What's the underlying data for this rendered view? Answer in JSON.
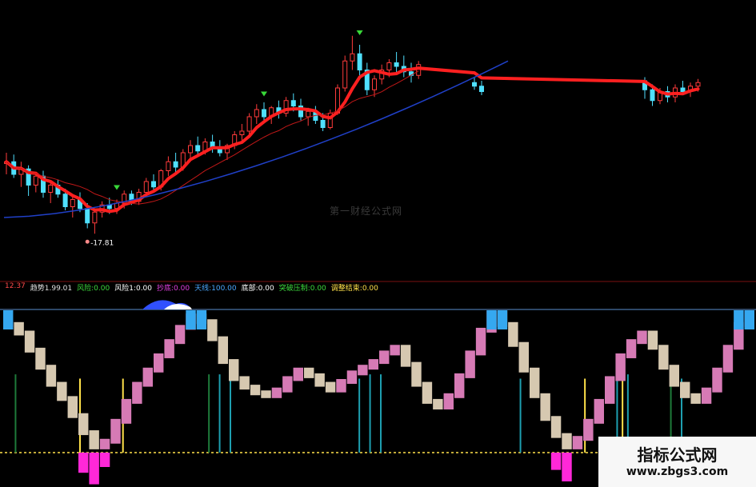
{
  "header": {
    "labels": [
      "...",
      "..."
    ]
  },
  "indicator_header": {
    "left_value": "12.37",
    "items": [
      {
        "text": "趋势1.99.01",
        "color": "#e0e0e0"
      },
      {
        "text": "风险:0.00",
        "color": "#3ddc3d"
      },
      {
        "text": "风险1:0.00",
        "color": "#ffffff"
      },
      {
        "text": "抄底:0.00",
        "color": "#e040e0"
      },
      {
        "text": "天线:100.00",
        "color": "#4aa8ff"
      },
      {
        "text": "底部:0.00",
        "color": "#ffffff"
      },
      {
        "text": "突破压制:0.00",
        "color": "#3ddc3d"
      },
      {
        "text": "调整结束:0.00",
        "color": "#ffe14a"
      }
    ]
  },
  "watermark_mid": "第一财经公式网",
  "logo": {
    "title": "指标公式网",
    "url": "www.zbgs3.com"
  },
  "chart_data": [
    {
      "type": "candlestick",
      "title": "",
      "annotations": [
        "-17.81"
      ],
      "ylim": [
        16,
        30
      ],
      "candles": [
        [
          21.8,
          22.4,
          21.2,
          21.9
        ],
        [
          21.9,
          22.3,
          21.0,
          21.2
        ],
        [
          21.2,
          21.9,
          20.5,
          21.5
        ],
        [
          21.5,
          21.7,
          20.0,
          20.6
        ],
        [
          20.6,
          21.3,
          20.2,
          21.1
        ],
        [
          21.1,
          21.4,
          19.9,
          20.2
        ],
        [
          20.2,
          20.8,
          19.6,
          20.6
        ],
        [
          20.6,
          20.9,
          19.9,
          20.1
        ],
        [
          20.1,
          20.4,
          19.2,
          19.4
        ],
        [
          19.4,
          20.0,
          18.8,
          19.8
        ],
        [
          19.8,
          20.2,
          19.1,
          19.3
        ],
        [
          19.3,
          19.6,
          18.2,
          18.5
        ],
        [
          18.5,
          19.3,
          17.9,
          19.1
        ],
        [
          19.1,
          19.7,
          18.8,
          19.5
        ],
        [
          19.5,
          19.9,
          19.0,
          19.3
        ],
        [
          19.3,
          19.8,
          19.0,
          19.6
        ],
        [
          19.6,
          20.3,
          19.3,
          20.1
        ],
        [
          20.1,
          20.3,
          19.5,
          19.7
        ],
        [
          19.7,
          20.4,
          19.5,
          20.2
        ],
        [
          20.2,
          21.0,
          20.0,
          20.8
        ],
        [
          20.8,
          21.2,
          20.3,
          20.5
        ],
        [
          20.5,
          21.5,
          20.3,
          21.4
        ],
        [
          21.4,
          22.2,
          21.1,
          21.9
        ],
        [
          21.9,
          22.4,
          21.3,
          21.6
        ],
        [
          21.6,
          22.6,
          21.4,
          22.4
        ],
        [
          22.4,
          23.1,
          22.0,
          22.8
        ],
        [
          22.8,
          23.3,
          22.2,
          22.5
        ],
        [
          22.5,
          23.2,
          22.3,
          23.0
        ],
        [
          23.0,
          23.4,
          22.4,
          22.7
        ],
        [
          22.7,
          23.1,
          22.2,
          22.4
        ],
        [
          22.4,
          22.9,
          22.0,
          22.8
        ],
        [
          22.8,
          23.6,
          22.6,
          23.4
        ],
        [
          23.4,
          24.0,
          23.0,
          23.6
        ],
        [
          23.6,
          24.6,
          23.4,
          24.4
        ],
        [
          24.4,
          25.1,
          24.0,
          24.8
        ],
        [
          24.8,
          25.2,
          24.1,
          24.4
        ],
        [
          24.4,
          25.0,
          24.0,
          24.9
        ],
        [
          24.9,
          25.3,
          24.3,
          24.6
        ],
        [
          24.6,
          25.5,
          24.4,
          25.3
        ],
        [
          25.3,
          25.7,
          24.7,
          25.0
        ],
        [
          25.0,
          25.4,
          24.2,
          24.4
        ],
        [
          24.4,
          24.9,
          23.9,
          24.7
        ],
        [
          24.7,
          25.0,
          24.0,
          24.2
        ],
        [
          24.2,
          24.6,
          23.6,
          23.8
        ],
        [
          23.8,
          24.8,
          23.7,
          24.6
        ],
        [
          24.6,
          26.2,
          24.5,
          26.0
        ],
        [
          26.0,
          27.8,
          25.8,
          27.5
        ],
        [
          27.5,
          28.9,
          27.0,
          27.9
        ],
        [
          27.9,
          28.4,
          26.7,
          27.0
        ],
        [
          27.0,
          27.4,
          25.6,
          25.9
        ],
        [
          25.9,
          26.7,
          25.5,
          26.5
        ],
        [
          26.5,
          27.3,
          26.2,
          27.0
        ],
        [
          27.0,
          27.6,
          26.6,
          27.4
        ],
        [
          27.4,
          28.0,
          26.8,
          27.2
        ],
        [
          27.2,
          27.8,
          26.6,
          26.9
        ],
        [
          26.9,
          27.4,
          26.3,
          26.7
        ],
        [
          26.7,
          27.5,
          26.5,
          27.3
        ]
      ],
      "gap_candles": [
        [
          26.3,
          26.6,
          25.9,
          26.1
        ],
        [
          26.1,
          26.4,
          25.6,
          25.8
        ]
      ],
      "right_candles": [
        [
          26.4,
          26.6,
          25.4,
          25.9
        ],
        [
          25.9,
          26.2,
          25.0,
          25.3
        ],
        [
          25.3,
          26.0,
          25.1,
          25.8
        ],
        [
          25.8,
          26.1,
          25.2,
          25.5
        ],
        [
          25.5,
          26.2,
          25.2,
          26.0
        ],
        [
          26.0,
          26.4,
          25.6,
          25.8
        ],
        [
          25.8,
          26.3,
          25.5,
          26.1
        ],
        [
          26.1,
          26.5,
          25.8,
          26.3
        ]
      ]
    },
    {
      "type": "bar",
      "title": "",
      "series": [
        {
          "values": [
            90,
            84,
            72,
            60,
            48,
            38,
            26,
            14,
            4,
            8,
            22,
            36,
            48,
            58,
            68,
            78,
            88,
            96,
            92,
            80,
            64,
            52,
            46,
            42,
            40,
            44,
            52,
            58,
            54,
            48,
            44,
            50,
            56,
            60,
            64,
            70,
            74,
            62,
            48,
            36,
            32,
            40,
            54,
            70,
            86,
            98,
            90,
            76,
            58,
            40,
            24,
            12,
            4,
            10,
            22,
            36,
            52,
            68,
            78,
            84,
            74,
            60,
            48,
            40,
            36,
            44,
            58,
            74,
            90,
            98
          ]
        },
        {
          "values": [
            0,
            0,
            0,
            0,
            0,
            0,
            0,
            14,
            22,
            10,
            0,
            0,
            0,
            0,
            0,
            0,
            0,
            0,
            0,
            0,
            0,
            0,
            0,
            0,
            0,
            0,
            0,
            0,
            0,
            0,
            0,
            0,
            0,
            0,
            0,
            0,
            0,
            0,
            0,
            0,
            0,
            0,
            0,
            0,
            0,
            0,
            0,
            0,
            0,
            0,
            0,
            12,
            20,
            0,
            0,
            0,
            0,
            0,
            0,
            0,
            0,
            0,
            0,
            0,
            0,
            0,
            0,
            0,
            0,
            0
          ]
        }
      ],
      "ylim": [
        0,
        100
      ]
    }
  ]
}
